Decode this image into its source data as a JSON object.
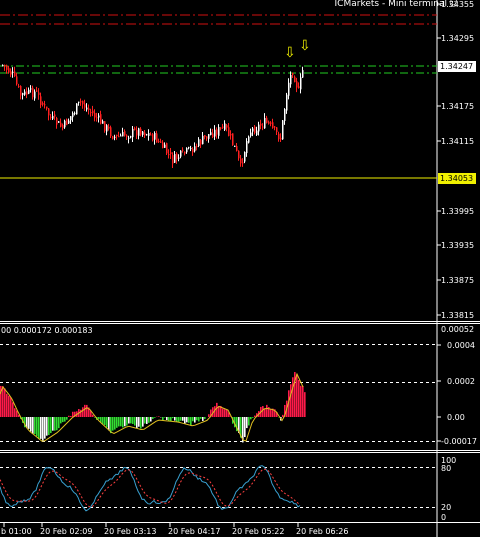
{
  "header": {
    "title": "ICMarkets - Mini terminal",
    "smiley": "☺"
  },
  "price_panel": {
    "ticks": [
      "1.34355",
      "1.34295",
      "1.34247",
      "1.34175",
      "1.34115",
      "1.34053",
      "1.33995",
      "1.33935",
      "1.33875",
      "1.33815"
    ],
    "bid_tag": "1.34247",
    "level_tag": "1.34053",
    "arrow_glyph": "⇩"
  },
  "macd_panel": {
    "header": "00 0.000172 0.000183",
    "ticks": [
      "0.00052",
      "0.0004",
      "0.0002",
      "0.00",
      "-0.00017"
    ]
  },
  "stoch_panel": {
    "ticks": [
      "100",
      "80",
      "20",
      "0"
    ]
  },
  "time_axis": {
    "labels": [
      "b 01:00",
      "20 Feb 02:09",
      "20 Feb 03:13",
      "20 Feb 04:17",
      "20 Feb 05:22",
      "20 Feb 06:26"
    ]
  },
  "colors": {
    "bull": "#ffffff",
    "bear": "#ff2020",
    "hist_up": "#ff1a4a",
    "hist_down": "#33dd33",
    "signal": "#e0c020",
    "stoch_main": "#39a0d0",
    "stoch_signal": "#ff4040",
    "resistance": "#d01010",
    "pivot": "#22cc22",
    "level": "#f0f000",
    "guide": "#ffffff"
  },
  "icons": {
    "smiley": "smiley-icon",
    "arrow": "down-arrow-icon"
  }
}
